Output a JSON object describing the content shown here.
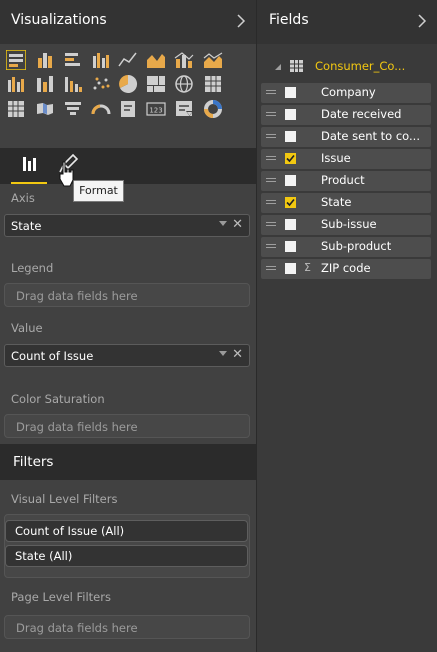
{
  "visualizations": {
    "title": "Visualizations",
    "tabs": {
      "format_tooltip": "Format"
    },
    "wells": {
      "axis": {
        "label": "Axis",
        "value": "State"
      },
      "legend": {
        "label": "Legend",
        "placeholder": "Drag data fields here"
      },
      "value": {
        "label": "Value",
        "value": "Count of Issue"
      },
      "color_saturation": {
        "label": "Color Saturation",
        "placeholder": "Drag data fields here"
      }
    },
    "filters": {
      "title": "Filters",
      "visual_level": {
        "label": "Visual Level Filters",
        "items": [
          "Count of Issue (All)",
          "State (All)"
        ]
      },
      "page_level": {
        "label": "Page Level Filters",
        "placeholder": "Drag data fields here"
      }
    },
    "icon_names": [
      "stacked-bar-chart-icon",
      "stacked-column-chart-icon",
      "clustered-bar-chart-icon",
      "clustered-column-chart-icon",
      "line-chart-icon",
      "area-chart-icon",
      "line-stacked-column-icon",
      "line-clustered-column-icon",
      "ribbon-chart-icon",
      "waterfall-chart-icon",
      "scatter-chart-icon",
      "pie-chart-icon",
      "treemap-icon",
      "map-icon",
      "table-icon",
      "matrix-icon",
      "filled-map-icon",
      "funnel-icon",
      "gauge-icon",
      "card-icon",
      "multirow-card-icon",
      "kpi-icon",
      "slicer-icon",
      "donut-chart-icon"
    ]
  },
  "fields": {
    "title": "Fields",
    "dataset": "Consumer_Co...",
    "items": [
      {
        "name": "Company",
        "checked": false,
        "sigma": false
      },
      {
        "name": "Date received",
        "checked": false,
        "sigma": false
      },
      {
        "name": "Date sent to co...",
        "checked": false,
        "sigma": false
      },
      {
        "name": "Issue",
        "checked": true,
        "sigma": false
      },
      {
        "name": "Product",
        "checked": false,
        "sigma": false
      },
      {
        "name": "State",
        "checked": true,
        "sigma": false
      },
      {
        "name": "Sub-issue",
        "checked": false,
        "sigma": false
      },
      {
        "name": "Sub-product",
        "checked": false,
        "sigma": false
      },
      {
        "name": "ZIP code",
        "checked": false,
        "sigma": true
      }
    ]
  },
  "colors": {
    "accent": "#f2c811",
    "pane_dark": "#2b2b2b",
    "pane_mid": "#414141"
  }
}
